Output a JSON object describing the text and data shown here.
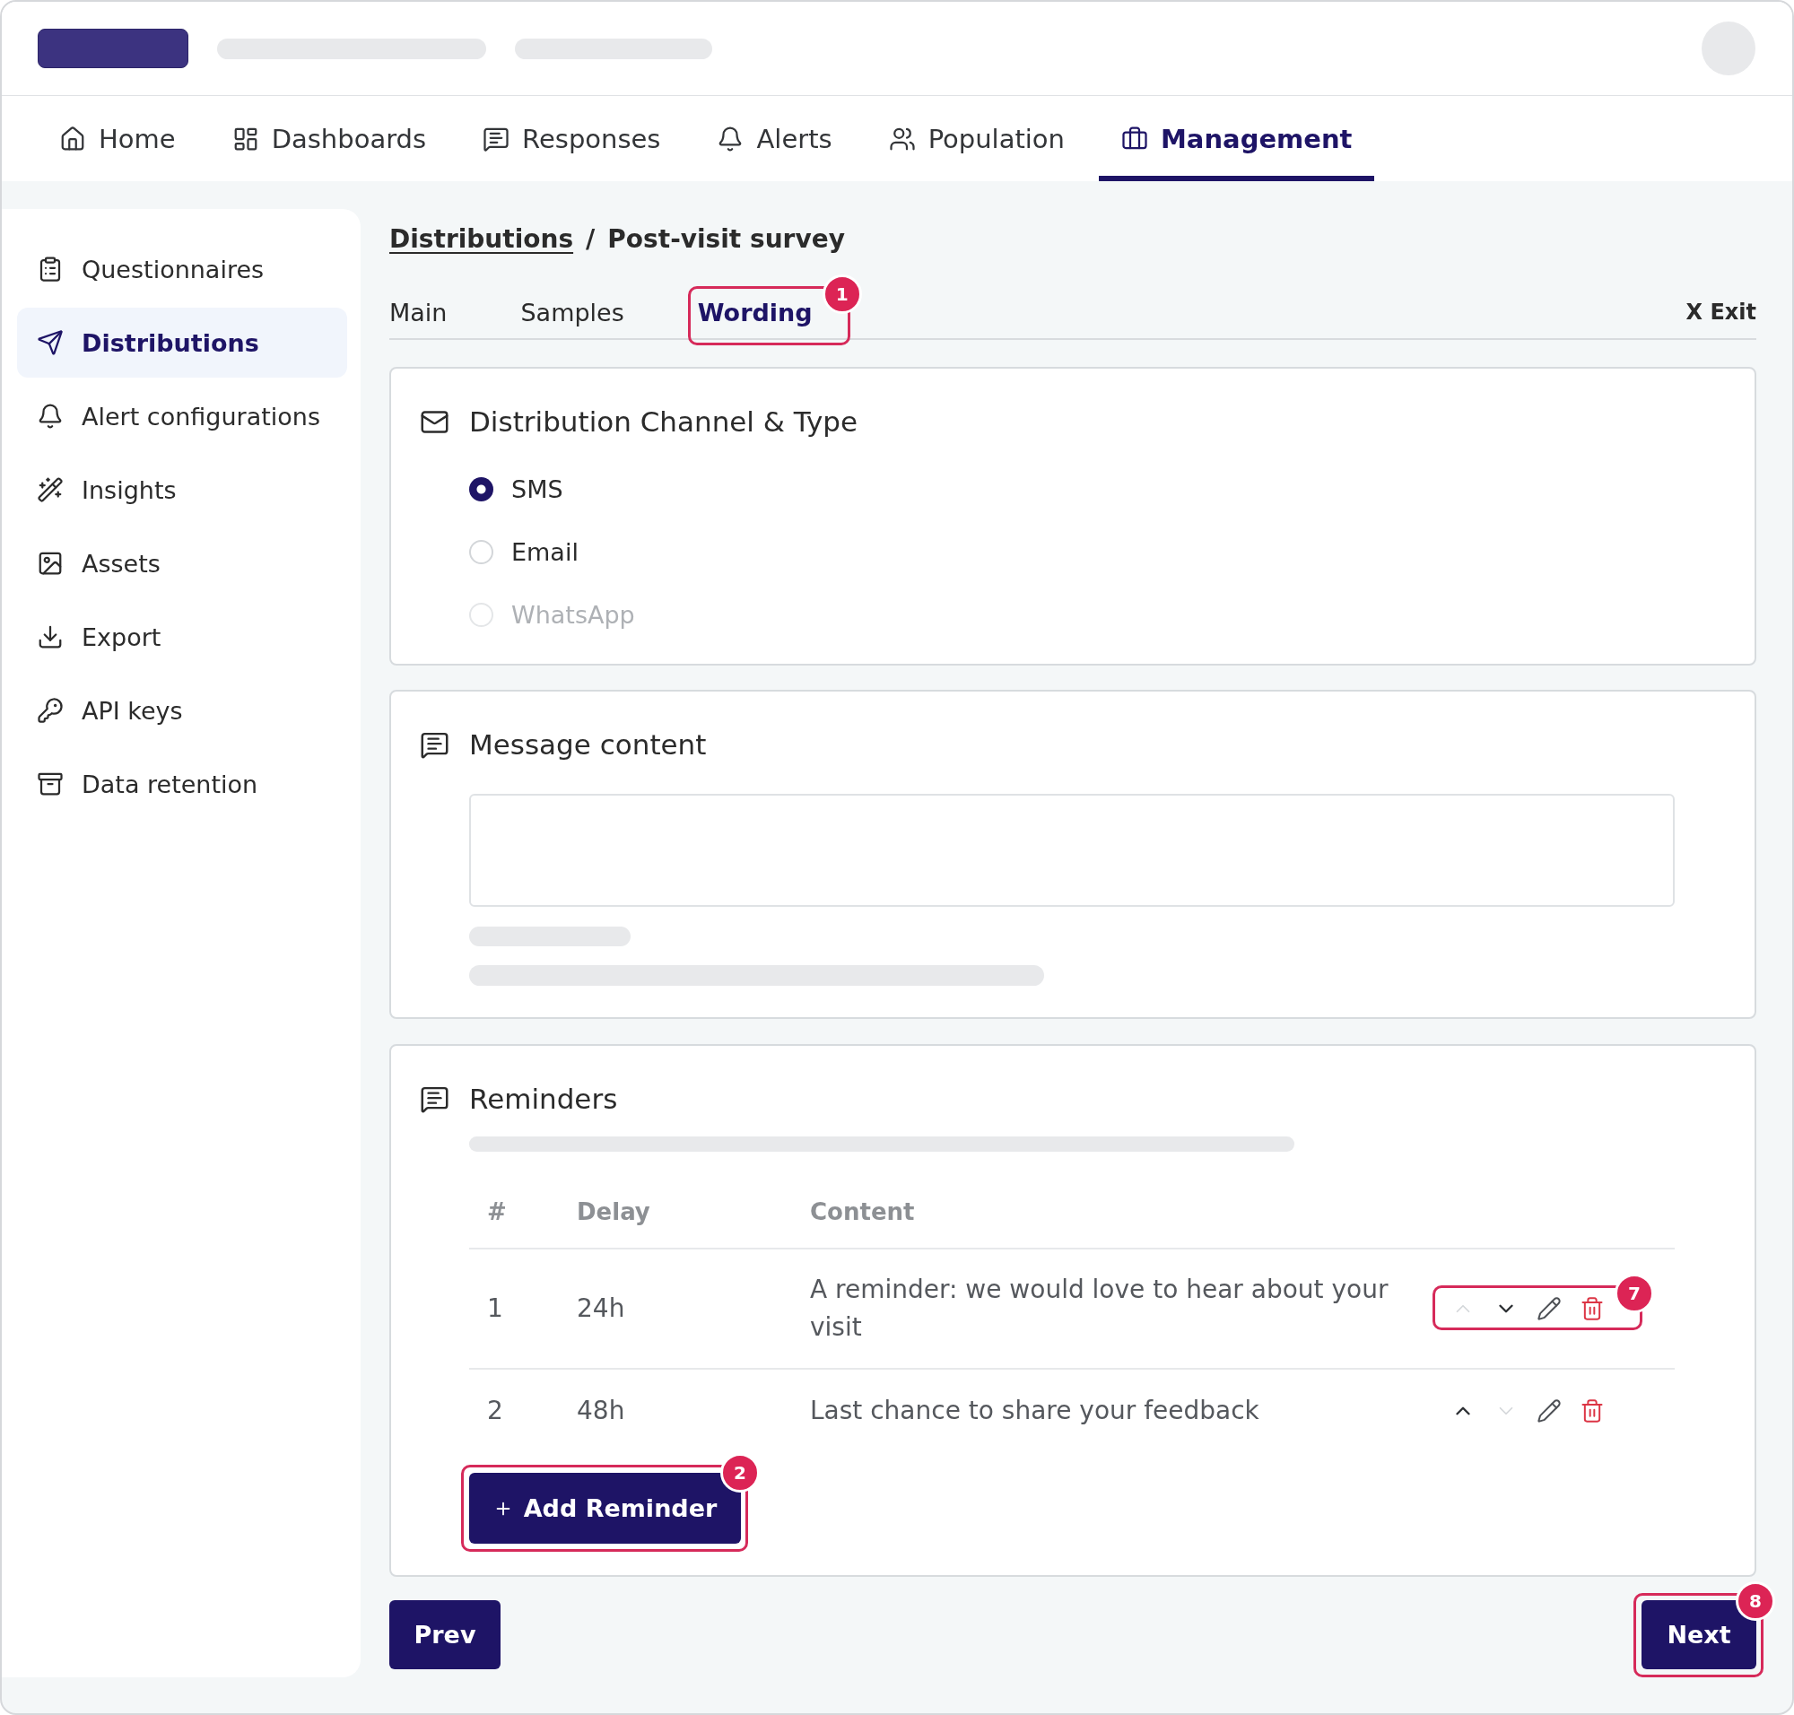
{
  "nav": {
    "items": [
      {
        "label": "Home",
        "selected": false
      },
      {
        "label": "Dashboards",
        "selected": false
      },
      {
        "label": "Responses",
        "selected": false
      },
      {
        "label": "Alerts",
        "selected": false
      },
      {
        "label": "Population",
        "selected": false
      },
      {
        "label": "Management",
        "selected": true
      }
    ]
  },
  "sidebar": {
    "items": [
      {
        "label": "Questionnaires",
        "selected": false
      },
      {
        "label": "Distributions",
        "selected": true
      },
      {
        "label": "Alert configurations",
        "selected": false
      },
      {
        "label": "Insights",
        "selected": false
      },
      {
        "label": "Assets",
        "selected": false
      },
      {
        "label": "Export",
        "selected": false
      },
      {
        "label": "API keys",
        "selected": false
      },
      {
        "label": "Data retention",
        "selected": false
      }
    ]
  },
  "breadcrumb": {
    "link": "Distributions",
    "separator": "/",
    "current": "Post-visit survey"
  },
  "tabs": {
    "items": [
      {
        "label": "Main",
        "selected": false
      },
      {
        "label": "Samples",
        "selected": false
      },
      {
        "label": "Wording",
        "selected": true,
        "annotation": "1"
      }
    ],
    "exit": "X Exit"
  },
  "channel_card": {
    "title": "Distribution Channel & Type",
    "options": [
      {
        "label": "SMS",
        "selected": true,
        "disabled": false
      },
      {
        "label": "Email",
        "selected": false,
        "disabled": false
      },
      {
        "label": "WhatsApp",
        "selected": false,
        "disabled": true
      }
    ]
  },
  "message_card": {
    "title": "Message content"
  },
  "reminders_card": {
    "title": "Reminders",
    "columns": [
      "#",
      "Delay",
      "Content"
    ],
    "rows": [
      {
        "number": "1",
        "delay": "24h",
        "content": "A reminder: we would love to hear about your visit",
        "up_disabled": true,
        "down_disabled": false,
        "annotation": "7"
      },
      {
        "number": "2",
        "delay": "48h",
        "content": "Last chance to share your feedback",
        "up_disabled": false,
        "down_disabled": true
      }
    ],
    "add_button": {
      "label": "Add Reminder",
      "annotation": "2"
    }
  },
  "footer": {
    "prev": {
      "label": "Prev"
    },
    "next": {
      "label": "Next",
      "annotation": "8"
    }
  }
}
